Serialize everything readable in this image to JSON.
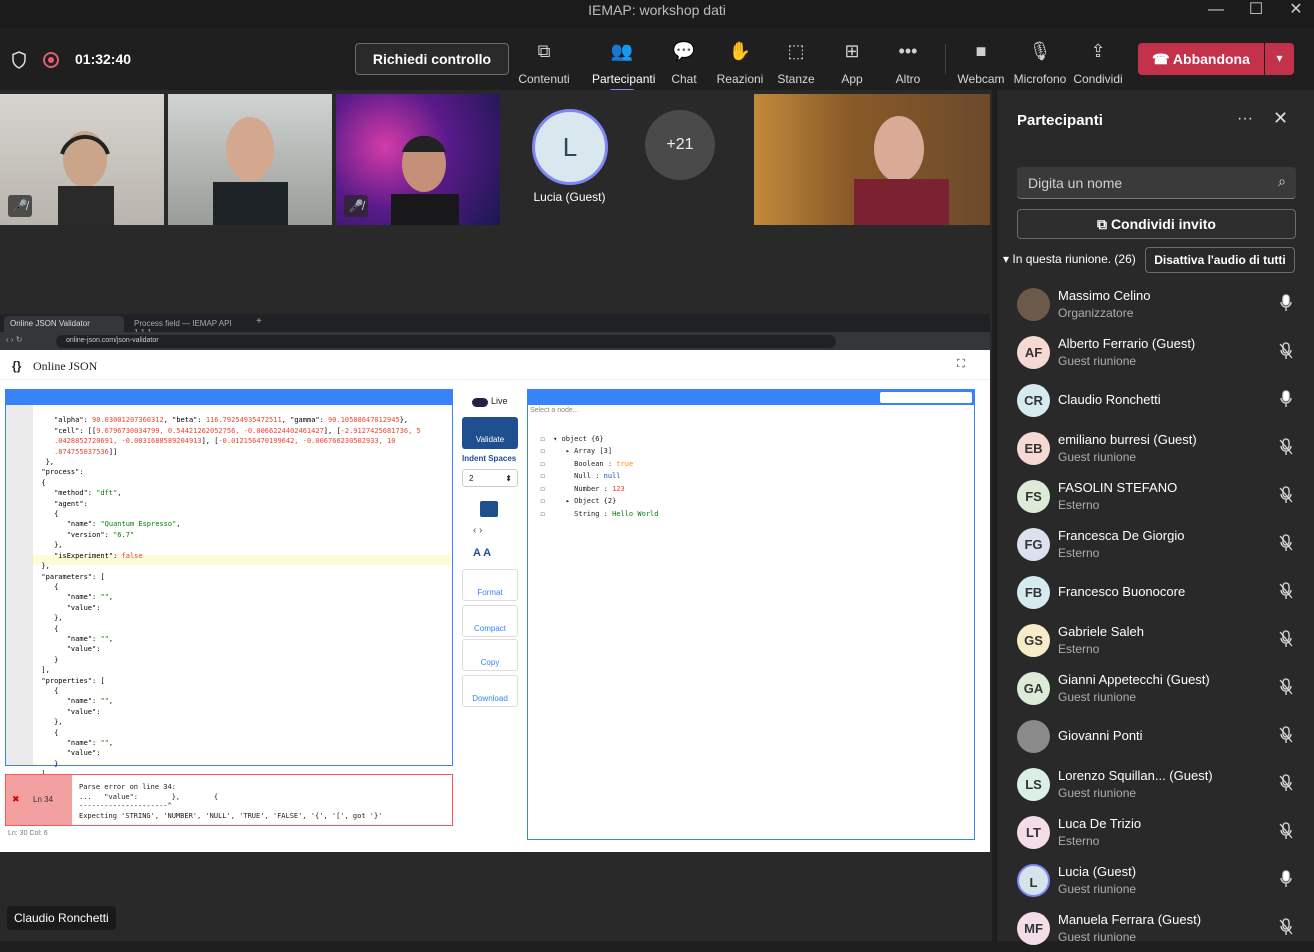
{
  "window": {
    "title": "IEMAP: workshop dati",
    "minimize": "—",
    "maximize": "☐",
    "close": "✕"
  },
  "meeting": {
    "timer": "01:32:40",
    "request_control": "Richiedi controllo",
    "toolbar": [
      {
        "label": "Contenuti",
        "icon": "share-content-icon"
      },
      {
        "label": "Partecipanti",
        "icon": "people-icon"
      },
      {
        "label": "Chat",
        "icon": "chat-icon"
      },
      {
        "label": "Reazioni",
        "icon": "reactions-icon"
      },
      {
        "label": "Stanze",
        "icon": "rooms-icon"
      },
      {
        "label": "App",
        "icon": "apps-icon"
      },
      {
        "label": "Altro",
        "icon": "more-icon"
      },
      {
        "label": "Webcam",
        "icon": "camera-icon"
      },
      {
        "label": "Microfono",
        "icon": "mic-icon"
      },
      {
        "label": "Condividi",
        "icon": "share-icon"
      }
    ],
    "leave": "Abbandona"
  },
  "stage": {
    "guest_initial": "L",
    "guest_name": "Lucia (Guest)",
    "overflow_count": "+21",
    "caption": "Claudio Ronchetti"
  },
  "browser": {
    "tab1": "Online JSON Validator",
    "tab2": "Process field — IEMAP API 1.1.1",
    "url": "online-json.com/json-validator",
    "app_logo": "{}",
    "app_name": "Online JSON"
  },
  "validator": {
    "live": "Live",
    "validate": "Validate",
    "indent_label": "Indent Spaces",
    "indent_value": "2",
    "format": "Format",
    "compact": "Compact",
    "copy": "Copy",
    "download": "Download",
    "select_node": "Select a node...",
    "error_line": "Ln 34",
    "error_msg": "Parse error on line 34:\n...   \"value\":        },        {\n---------------------^\nExpecting 'STRING', 'NUMBER', 'NULL', 'TRUE', 'FALSE', '{', '[', got '}'",
    "status": "Ln: 30   Col: 6"
  },
  "participants_panel": {
    "title": "Partecipanti",
    "search_placeholder": "Digita un nome",
    "invite": "Condividi invito",
    "section": "In questa riunione. (26)",
    "mute_all": "Disattiva l'audio di tutti",
    "people": [
      {
        "name": "Massimo Celino",
        "role": "Organizzatore",
        "initials": "",
        "color": "#6b5a4a",
        "mic": "on"
      },
      {
        "name": "Alberto Ferrario (Guest)",
        "role": "Guest riunione",
        "initials": "AF",
        "color": "#f5d9d3",
        "mic": "off"
      },
      {
        "name": "Claudio Ronchetti",
        "role": "",
        "initials": "CR",
        "color": "#d6eaf0",
        "mic": "on"
      },
      {
        "name": "emiliano burresi (Guest)",
        "role": "Guest riunione",
        "initials": "EB",
        "color": "#f5d9d3",
        "mic": "off"
      },
      {
        "name": "FASOLIN STEFANO",
        "role": "Esterno",
        "initials": "FS",
        "color": "#dcebd8",
        "mic": "off"
      },
      {
        "name": "Francesca De Giorgio",
        "role": "Esterno",
        "initials": "FG",
        "color": "#dde0ef",
        "mic": "off"
      },
      {
        "name": "Francesco Buonocore",
        "role": "",
        "initials": "FB",
        "color": "#d6eaf0",
        "mic": "off"
      },
      {
        "name": "Gabriele Saleh",
        "role": "Esterno",
        "initials": "GS",
        "color": "#f7ecc8",
        "mic": "off"
      },
      {
        "name": "Gianni Appetecchi (Guest)",
        "role": "Guest riunione",
        "initials": "GA",
        "color": "#dcebd8",
        "mic": "off"
      },
      {
        "name": "Giovanni Ponti",
        "role": "",
        "initials": "",
        "color": "#8a8a8a",
        "mic": "off"
      },
      {
        "name": "Lorenzo Squillan... (Guest)",
        "role": "Guest riunione",
        "initials": "LS",
        "color": "#dcefe6",
        "mic": "off"
      },
      {
        "name": "Luca De Trizio",
        "role": "Esterno",
        "initials": "LT",
        "color": "#f3dde6",
        "mic": "off"
      },
      {
        "name": "Lucia (Guest)",
        "role": "Guest riunione",
        "initials": "L",
        "color": "#d6e3ea",
        "mic": "on"
      },
      {
        "name": "Manuela Ferrara (Guest)",
        "role": "Guest riunione",
        "initials": "MF",
        "color": "#f3dde6",
        "mic": "off"
      }
    ]
  },
  "colors": {
    "accent": "#7f85f5",
    "leave": "#c4314b",
    "json_blue": "#3883fa"
  }
}
